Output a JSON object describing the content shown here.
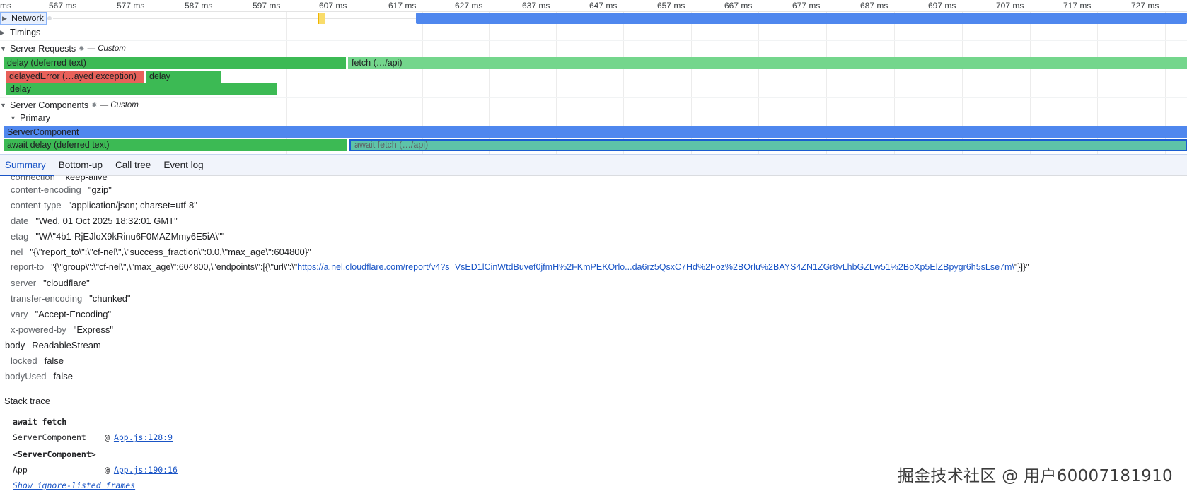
{
  "ruler": {
    "ticks": [
      "ms",
      "567 ms",
      "577 ms",
      "587 ms",
      "597 ms",
      "607 ms",
      "617 ms",
      "627 ms",
      "637 ms",
      "647 ms",
      "657 ms",
      "667 ms",
      "677 ms",
      "687 ms",
      "697 ms",
      "707 ms",
      "717 ms",
      "727 ms"
    ]
  },
  "tracks": {
    "network": {
      "label": "Network",
      "expanded": false
    },
    "timings": {
      "label": "Timings",
      "expanded": false
    },
    "server_requests": {
      "label": "Server Requests",
      "custom": "— Custom",
      "expanded": true,
      "bars": {
        "delay_deferred": "delay (deferred text)",
        "fetch_api": "fetch (…/api)",
        "delayed_error": "delayedError (…ayed exception)",
        "delay_b": "delay",
        "delay_c": "delay"
      }
    },
    "server_components": {
      "label": "Server Components",
      "custom": "— Custom",
      "expanded": true,
      "primary_label": "Primary",
      "bars": {
        "server_component": "ServerComponent",
        "await_delay": "await delay (deferred text)",
        "await_fetch": "await fetch (…/api)"
      }
    }
  },
  "tabs": {
    "summary": "Summary",
    "bottom_up": "Bottom-up",
    "call_tree": "Call tree",
    "event_log": "Event log",
    "active": "Summary"
  },
  "headers": {
    "connection": {
      "key": "connection",
      "value": "\"keep-alive\""
    },
    "content_encoding": {
      "key": "content-encoding",
      "value": "\"gzip\""
    },
    "content_type": {
      "key": "content-type",
      "value": "\"application/json; charset=utf-8\""
    },
    "date": {
      "key": "date",
      "value": "\"Wed, 01 Oct 2025 18:32:01 GMT\""
    },
    "etag": {
      "key": "etag",
      "value": "\"W/\\\"4b1-RjEJloX9kRinu6F0MAZMmy6E5iA\\\"\""
    },
    "nel": {
      "key": "nel",
      "value": "\"{\\\"report_to\\\":\\\"cf-nel\\\",\\\"success_fraction\\\":0.0,\\\"max_age\\\":604800}\""
    },
    "report_to": {
      "key": "report-to",
      "value_prefix": "\"{\\\"group\\\":\\\"cf-nel\\\",\\\"max_age\\\":604800,\\\"endpoints\\\":[{\\\"url\\\":\\\"",
      "link": "https://a.nel.cloudflare.com/report/v4?s=VsED1lCinWtdBuvef0jfmH%2FKmPEKOrlo...da6rz5QsxC7Hd%2Foz%2BOrlu%2BAYS4ZN1ZGr8vLhbGZLw51%2BoXp5ElZBpygr6h5sLse7m\\",
      "value_suffix": "\"}]}\""
    },
    "server": {
      "key": "server",
      "value": "\"cloudflare\""
    },
    "transfer_encoding": {
      "key": "transfer-encoding",
      "value": "\"chunked\""
    },
    "vary": {
      "key": "vary",
      "value": "\"Accept-Encoding\""
    },
    "x_powered_by": {
      "key": "x-powered-by",
      "value": "\"Express\""
    }
  },
  "body_props": {
    "body": {
      "key": "body",
      "value": "ReadableStream"
    },
    "locked": {
      "key": "locked",
      "value": "false"
    },
    "body_used": {
      "key": "bodyUsed",
      "value": "false"
    }
  },
  "stack": {
    "title": "Stack trace",
    "await_fetch": "await fetch",
    "frame1": {
      "fn": "ServerComponent",
      "at": "@",
      "src": "App.js:128:9"
    },
    "server_component_tag": "<ServerComponent>",
    "frame2": {
      "fn": "App",
      "at": "@",
      "src": "App.js:190:16"
    },
    "ignore_link": "Show ignore-listed frames"
  },
  "watermark": "掘金技术社区 @ 用户60007181910",
  "colors": {
    "green": "#3cba54",
    "light_green": "#74d68c",
    "red": "#e8615a",
    "blue": "#4f87ee",
    "teal": "#5ec3a8",
    "link": "#1a55c6"
  }
}
